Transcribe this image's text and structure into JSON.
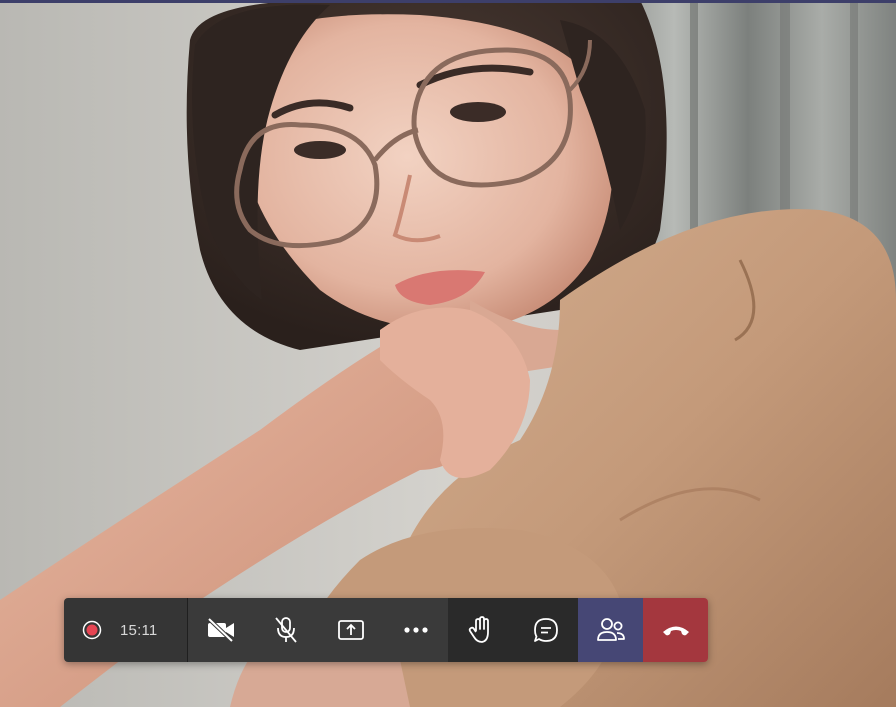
{
  "call": {
    "recording": {
      "icon": "record-icon",
      "color": "#e64553"
    },
    "timer": "15:11"
  },
  "toolbar": {
    "buttons": [
      {
        "name": "camera-toggle-button",
        "icon": "camera-off-icon",
        "state": "off"
      },
      {
        "name": "mic-toggle-button",
        "icon": "mic-off-icon",
        "state": "off"
      },
      {
        "name": "share-screen-button",
        "icon": "share-tray-icon"
      },
      {
        "name": "more-actions-button",
        "icon": "more-icon"
      },
      {
        "name": "raise-hand-button",
        "icon": "hand-icon"
      },
      {
        "name": "show-conversation-button",
        "icon": "chat-icon"
      },
      {
        "name": "show-participants-button",
        "icon": "participants-icon",
        "state": "active"
      },
      {
        "name": "hang-up-button",
        "icon": "hang-up-icon"
      }
    ]
  },
  "colors": {
    "toolbar_bg": "#3a3a3a",
    "toolbar_dark": "#2a2a2a",
    "active_accent": "#464775",
    "hangup_red": "#a4373e",
    "top_strip": "#3d3f6a",
    "icon_color": "#ffffff"
  }
}
